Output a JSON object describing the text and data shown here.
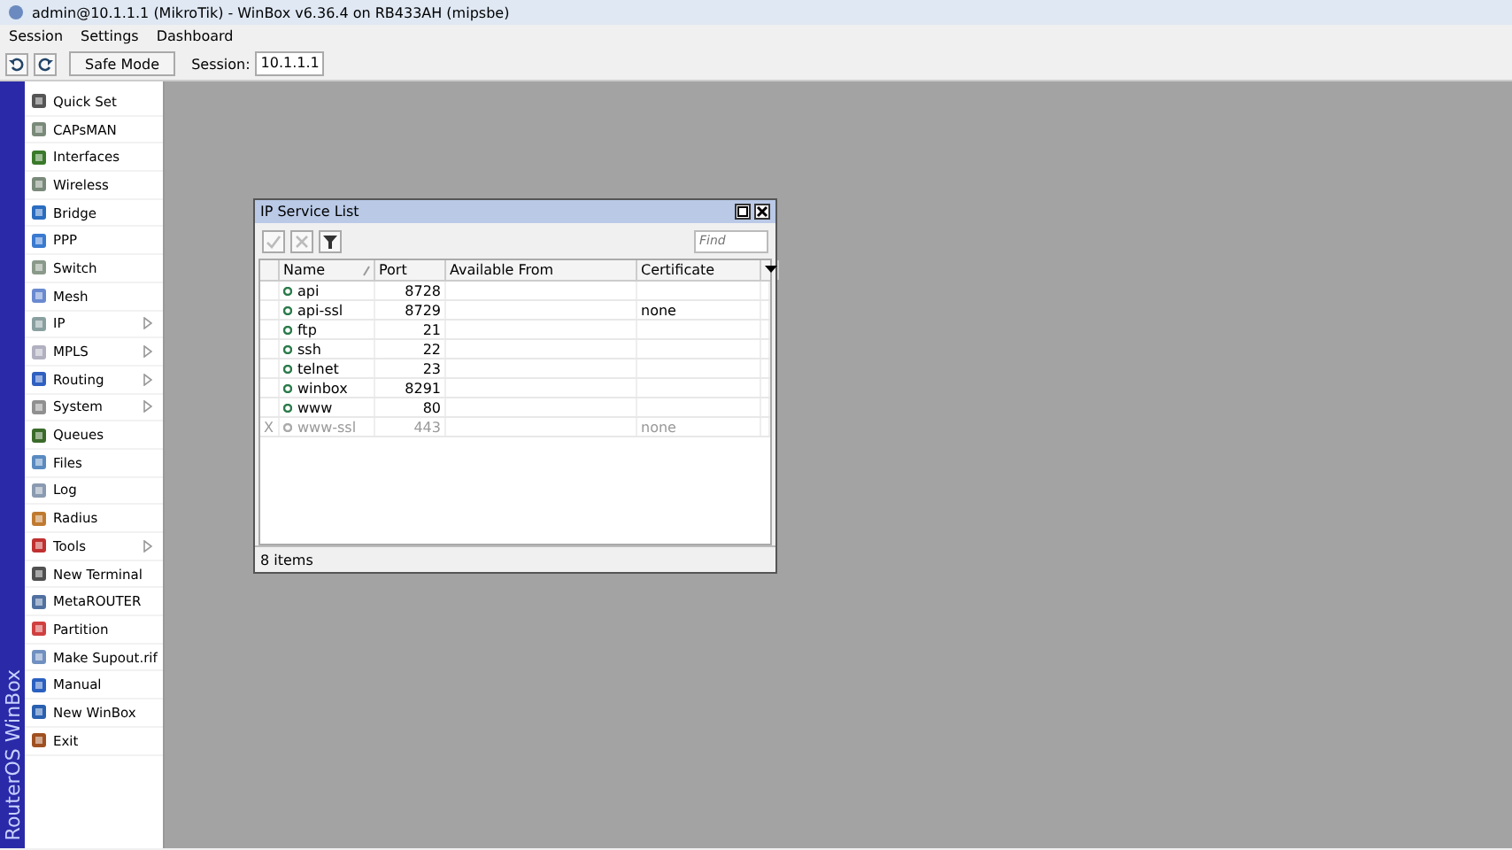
{
  "window": {
    "title": "admin@10.1.1.1 (MikroTik) - WinBox v6.36.4 on RB433AH (mipsbe)"
  },
  "menu": [
    "Session",
    "Settings",
    "Dashboard"
  ],
  "toolbar": {
    "safe_mode": "Safe Mode",
    "session_label": "Session:",
    "session_value": "10.1.1.1"
  },
  "sidebar": {
    "brand": "RouterOS WinBox",
    "items": [
      {
        "label": "Quick Set",
        "submenu": false
      },
      {
        "label": "CAPsMAN",
        "submenu": false
      },
      {
        "label": "Interfaces",
        "submenu": false
      },
      {
        "label": "Wireless",
        "submenu": false
      },
      {
        "label": "Bridge",
        "submenu": false
      },
      {
        "label": "PPP",
        "submenu": false
      },
      {
        "label": "Switch",
        "submenu": false
      },
      {
        "label": "Mesh",
        "submenu": false
      },
      {
        "label": "IP",
        "submenu": true
      },
      {
        "label": "MPLS",
        "submenu": true
      },
      {
        "label": "Routing",
        "submenu": true
      },
      {
        "label": "System",
        "submenu": true
      },
      {
        "label": "Queues",
        "submenu": false
      },
      {
        "label": "Files",
        "submenu": false
      },
      {
        "label": "Log",
        "submenu": false
      },
      {
        "label": "Radius",
        "submenu": false
      },
      {
        "label": "Tools",
        "submenu": true
      },
      {
        "label": "New Terminal",
        "submenu": false
      },
      {
        "label": "MetaROUTER",
        "submenu": false
      },
      {
        "label": "Partition",
        "submenu": false
      },
      {
        "label": "Make Supout.rif",
        "submenu": false
      },
      {
        "label": "Manual",
        "submenu": false
      },
      {
        "label": "New WinBox",
        "submenu": false
      },
      {
        "label": "Exit",
        "submenu": false
      }
    ]
  },
  "service_window": {
    "title": "IP Service List",
    "find_placeholder": "Find",
    "columns": [
      "Name",
      "Port",
      "Available From",
      "Certificate"
    ],
    "rows": [
      {
        "name": "api",
        "port": "8728",
        "available_from": "",
        "certificate": "",
        "disabled": false
      },
      {
        "name": "api-ssl",
        "port": "8729",
        "available_from": "",
        "certificate": "none",
        "disabled": false
      },
      {
        "name": "ftp",
        "port": "21",
        "available_from": "",
        "certificate": "",
        "disabled": false
      },
      {
        "name": "ssh",
        "port": "22",
        "available_from": "",
        "certificate": "",
        "disabled": false
      },
      {
        "name": "telnet",
        "port": "23",
        "available_from": "",
        "certificate": "",
        "disabled": false
      },
      {
        "name": "winbox",
        "port": "8291",
        "available_from": "",
        "certificate": "",
        "disabled": false
      },
      {
        "name": "www",
        "port": "80",
        "available_from": "",
        "certificate": "",
        "disabled": false
      },
      {
        "name": "www-ssl",
        "port": "443",
        "available_from": "",
        "certificate": "none",
        "disabled": true,
        "flag": "X"
      }
    ],
    "status": "8 items"
  }
}
